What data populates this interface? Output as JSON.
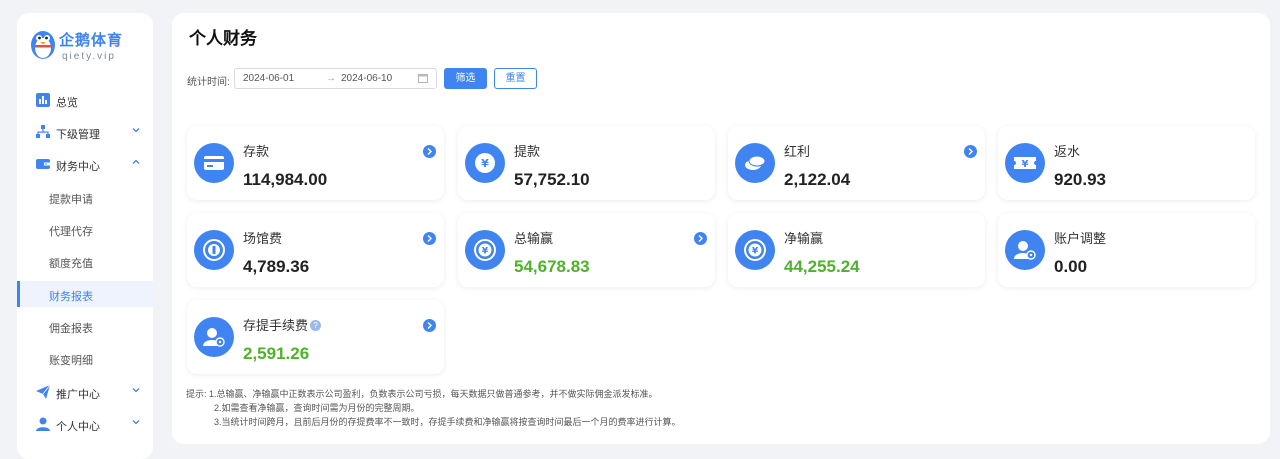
{
  "brand": {
    "name": "企鹅体育",
    "domain": "qiety.vip"
  },
  "sidebar": {
    "items": [
      {
        "label": "总览"
      },
      {
        "label": "下级管理"
      },
      {
        "label": "财务中心"
      },
      {
        "label": "推广中心"
      },
      {
        "label": "个人中心"
      }
    ],
    "finance_sub": [
      {
        "label": "提款申请"
      },
      {
        "label": "代理代存"
      },
      {
        "label": "额度充值"
      },
      {
        "label": "财务报表"
      },
      {
        "label": "佣金报表"
      },
      {
        "label": "账变明细"
      }
    ]
  },
  "main": {
    "title": "个人财务",
    "filter": {
      "label": "统计时间:",
      "start_date": "2024-06-01",
      "separator": "→",
      "end_date": "2024-06-10",
      "filter_button": "筛选",
      "reset_button": "重置"
    },
    "cards": [
      {
        "title": "存款",
        "value": "114,984.00",
        "icon": "card-icon"
      },
      {
        "title": "提款",
        "value": "57,752.10",
        "icon": "yen-coin-icon"
      },
      {
        "title": "红利",
        "value": "2,122.04",
        "icon": "coins-icon"
      },
      {
        "title": "返水",
        "value": "920.93",
        "icon": "yen-ticket-icon"
      },
      {
        "title": "场馆费",
        "value": "4,789.36",
        "icon": "venue-coin-icon"
      },
      {
        "title": "总输赢",
        "value": "54,678.83",
        "icon": "yen-coin-icon"
      },
      {
        "title": "净输赢",
        "value": "44,255.24",
        "icon": "yen-coin-icon"
      },
      {
        "title": "账户调整",
        "value": "0.00",
        "icon": "user-gear-icon"
      },
      {
        "title": "存提手续费",
        "value": "2,591.26",
        "icon": "user-gear-icon",
        "help": "?"
      }
    ],
    "notes": [
      "提示:  1.总输赢、净输赢中正数表示公司盈利，负数表示公司亏损，每天数据只做普通参考，并不做实际佣金派发标准。",
      "2.如需查看净输赢，查询时间需为月份的完整周期。",
      "3.当统计时间跨月，且前后月份的存提费率不一致时，存提手续费和净输赢将按查询时间最后一个月的费率进行计算。"
    ]
  },
  "colors": {
    "accent": "#3f84f0",
    "positive": "#4fb22a"
  }
}
